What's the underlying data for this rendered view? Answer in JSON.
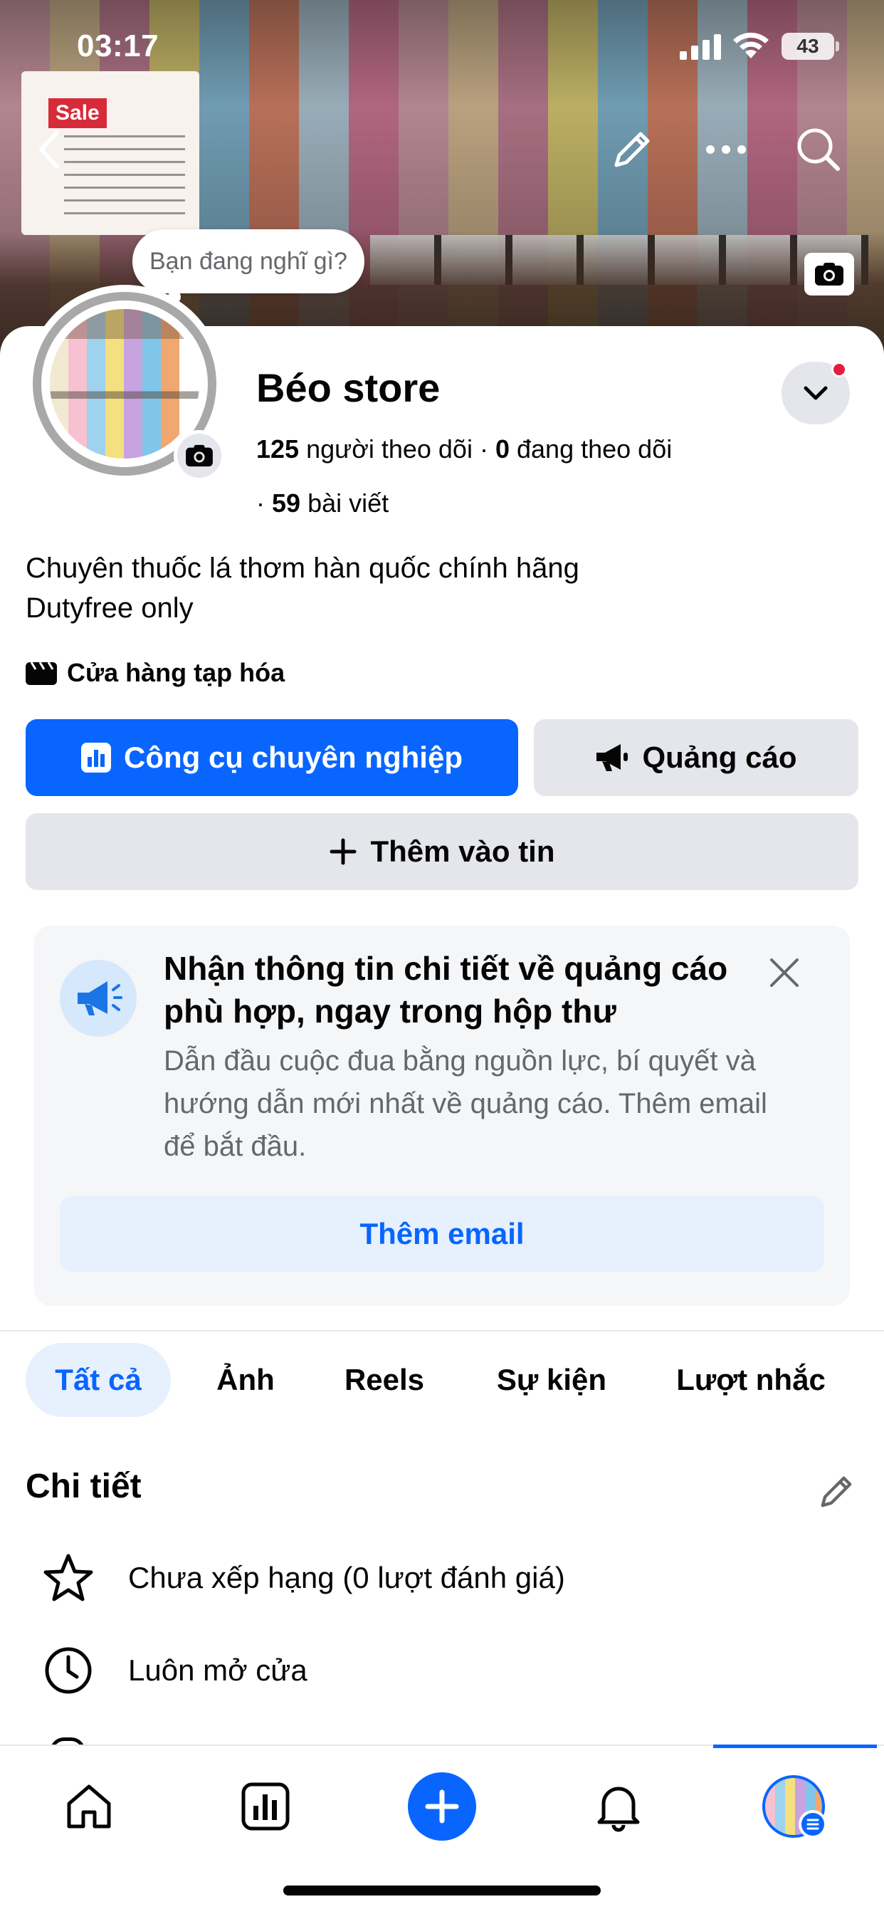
{
  "status_bar": {
    "time": "03:17",
    "battery": "43"
  },
  "cover": {
    "sign_text": "Sale",
    "nav_icons": [
      "back-icon",
      "edit-icon",
      "more-icon",
      "search-icon"
    ]
  },
  "composer_bubble": "Bạn đang nghĩ gì?",
  "profile": {
    "name": "Béo store",
    "followers_count": "125",
    "followers_label": "người theo dõi",
    "following_count": "0",
    "following_label": "đang theo dõi",
    "posts_count": "59",
    "posts_label": "bài viết",
    "bio_line1": "Chuyên thuốc lá thơm hàn quốc chính hãng",
    "bio_line2": "Dutyfree only",
    "category": "Cửa hàng tạp hóa"
  },
  "actions": {
    "pro_tools": "Công cụ chuyên nghiệp",
    "ads": "Quảng cáo",
    "add_story": "Thêm vào tin"
  },
  "info_card": {
    "title": "Nhận thông tin chi tiết về quảng cáo phù hợp, ngay trong hộp thư",
    "description": "Dẫn đầu cuộc đua bằng nguồn lực, bí quyết và hướng dẫn mới nhất về quảng cáo. Thêm email để bắt đầu.",
    "button": "Thêm email"
  },
  "tabs": [
    {
      "label": "Tất cả",
      "active": true
    },
    {
      "label": "Ảnh",
      "active": false
    },
    {
      "label": "Reels",
      "active": false
    },
    {
      "label": "Sự kiện",
      "active": false
    },
    {
      "label": "Lượt nhắc",
      "active": false
    }
  ],
  "details": {
    "title": "Chi tiết",
    "rating": "Chưa xếp hạng (0 lượt đánh giá)",
    "hours": "Luôn mở cửa"
  },
  "bottom_nav": [
    "home-icon",
    "dashboard-icon",
    "create-icon",
    "notifications-icon",
    "profile-icon"
  ],
  "colors": {
    "accent": "#0866ff",
    "badge": "#e41e3f",
    "secondary_button": "#e4e6eb",
    "muted_text": "#65676b"
  }
}
